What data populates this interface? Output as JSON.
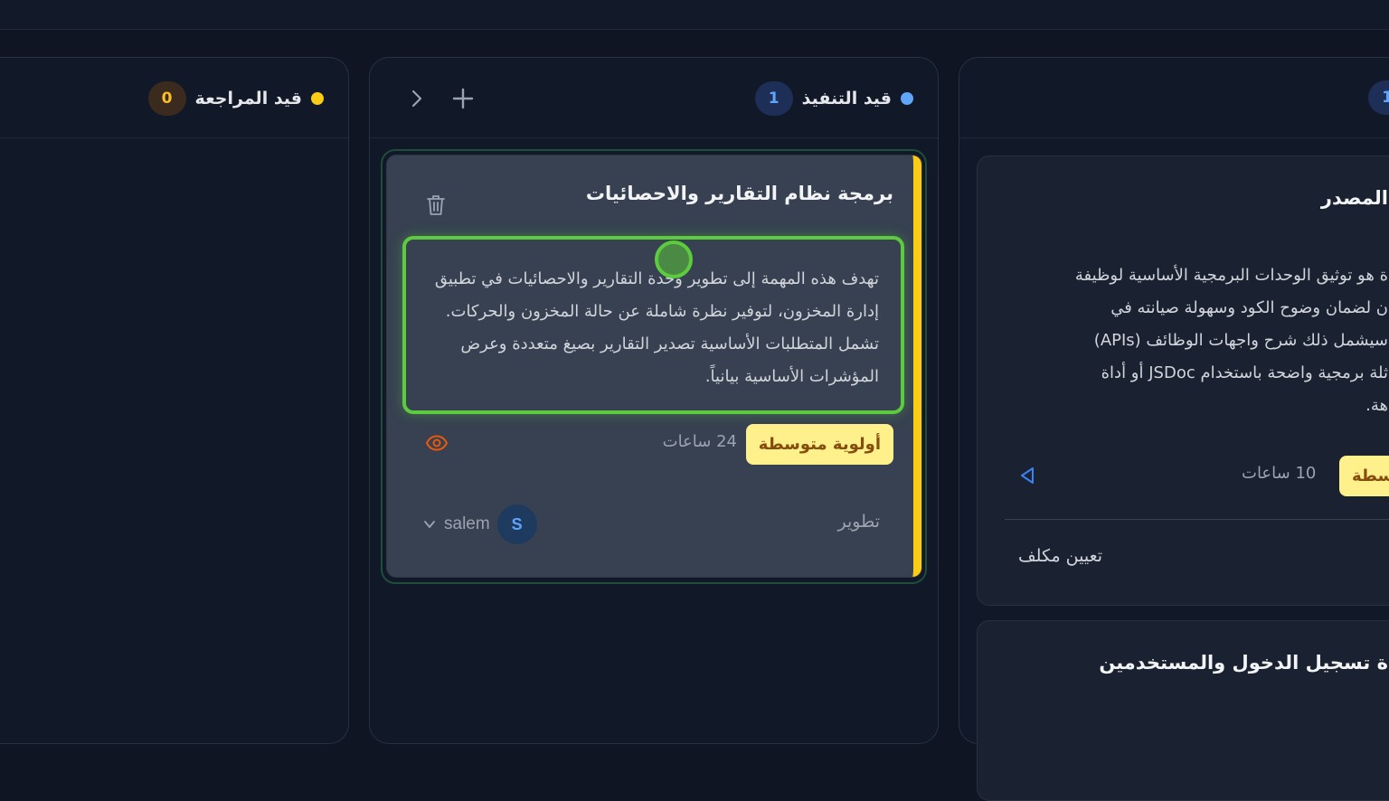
{
  "columns": {
    "review": {
      "title": "قيد المراجعة",
      "count": "0",
      "dot_color": "#facc15"
    },
    "in_progress": {
      "title": "قيد التنفيذ",
      "count": "1",
      "dot_color": "#60a5fa"
    },
    "right": {
      "count": "1"
    }
  },
  "card": {
    "title": "برمجة نظام التقارير والاحصائيات",
    "description": "تهدف هذه المهمة إلى تطوير وحدة التقارير والاحصائيات في تطبيق إدارة المخزون، لتوفير نظرة شاملة عن حالة المخزون والحركات. تشمل المتطلبات الأساسية تصدير التقارير بصيغ متعددة وعرض المؤشرات الأساسية بيانياً.",
    "priority": "أولوية متوسطة",
    "hours": "24 ساعات",
    "category": "تطوير",
    "assignee": {
      "name": "salem",
      "initial": "S"
    },
    "accent_color": "#facc15"
  },
  "right_cards": {
    "first": {
      "title": "المصدر",
      "description": "ة هو توثيق الوحدات البرمجية الأساسية لوظيفة\nن لضمان وضوح الكود وسهولة صيانته في\nسيشمل ذلك شرح واجهات الوظائف (APIs)\nثلة برمجية واضحة باستخدام JSDoc أو أداة\nهة.",
      "priority": "سطة",
      "hours": "10 ساعات",
      "assign": "تعيين مكلف"
    },
    "second": {
      "title": "ة تسجيل الدخول والمستخدمين"
    }
  }
}
